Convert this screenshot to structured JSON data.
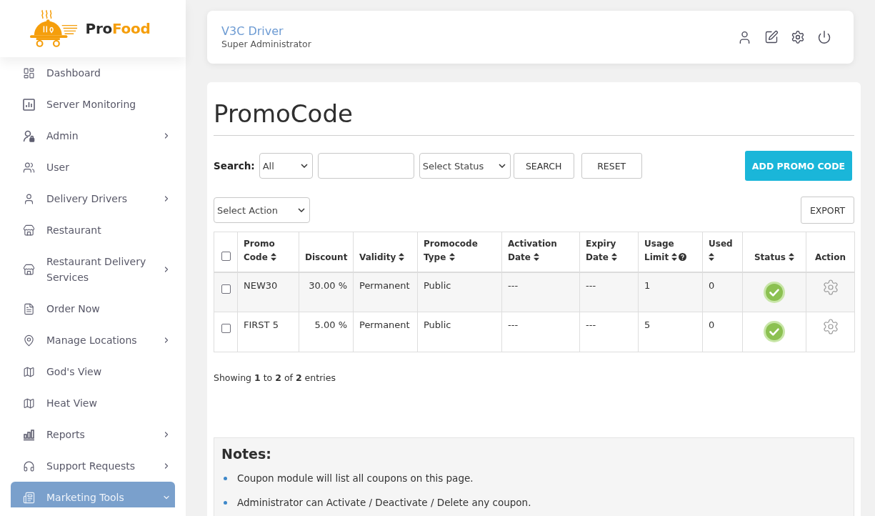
{
  "brand": {
    "prefix": "Pro",
    "suffix": "Food"
  },
  "sidebar": {
    "items": [
      {
        "label": "Dashboard",
        "selected": false
      },
      {
        "label": "Server Monitoring",
        "selected": false
      },
      {
        "label": "Admin",
        "selected": false,
        "expanded": false
      },
      {
        "label": "User",
        "selected": false
      },
      {
        "label": "Delivery Drivers",
        "selected": false,
        "expanded": false
      },
      {
        "label": "Restaurant",
        "selected": false
      },
      {
        "label": "Restaurant Delivery Services",
        "selected": false,
        "expanded": false
      },
      {
        "label": "Order Now",
        "selected": false
      },
      {
        "label": "Manage Locations",
        "selected": false,
        "expanded": false
      },
      {
        "label": "God's View",
        "selected": false
      },
      {
        "label": "Heat View",
        "selected": false
      },
      {
        "label": "Reports",
        "selected": false,
        "expanded": false
      },
      {
        "label": "Support Requests",
        "selected": false,
        "expanded": false
      },
      {
        "label": "Marketing Tools",
        "selected": true,
        "expanded": true
      }
    ]
  },
  "header": {
    "user_name": "V3C Driver",
    "user_role": "Super Administrator"
  },
  "page": {
    "title": "PromoCode"
  },
  "filters": {
    "label": "Search:",
    "field_select": "All",
    "status_select": "Select Status",
    "search_button": "SEARCH",
    "reset_button": "RESET",
    "add_button": "ADD PROMO CODE"
  },
  "actions": {
    "action_select": "Select Action",
    "export_button": "EXPORT"
  },
  "table": {
    "select_all": {
      "checked": false
    },
    "columns": [
      {
        "label": "Promo Code",
        "sortable": true,
        "help": false
      },
      {
        "label": "Discount",
        "sortable": false,
        "help": false
      },
      {
        "label": "Validity",
        "sortable": true,
        "help": false
      },
      {
        "label": "Promocode Type",
        "sortable": true,
        "help": false
      },
      {
        "label": "Activation Date",
        "sortable": true,
        "help": false
      },
      {
        "label": "Expiry Date",
        "sortable": true,
        "help": false
      },
      {
        "label": "Usage Limit",
        "sortable": true,
        "help": true
      },
      {
        "label": "Used",
        "sortable": true,
        "help": false
      },
      {
        "label": "Status",
        "sortable": true,
        "help": false
      },
      {
        "label": "Action",
        "sortable": false,
        "help": false
      }
    ],
    "rows": [
      {
        "checked": false,
        "cells": [
          "NEW30",
          "30.00 %",
          "Permanent",
          "Public",
          "---",
          "---",
          "1",
          "0"
        ],
        "active": true
      },
      {
        "checked": false,
        "cells": [
          "FIRST 5",
          "5.00 %",
          "Permanent",
          "Public",
          "---",
          "---",
          "5",
          "0"
        ],
        "active": true
      }
    ]
  },
  "summary": "Showing **1** to **2** of **2** entries",
  "notes": {
    "title": "Notes:",
    "items": [
      "Coupon module will list all coupons on this page.",
      "Administrator can Activate / Deactivate / Delete any coupon."
    ]
  }
}
